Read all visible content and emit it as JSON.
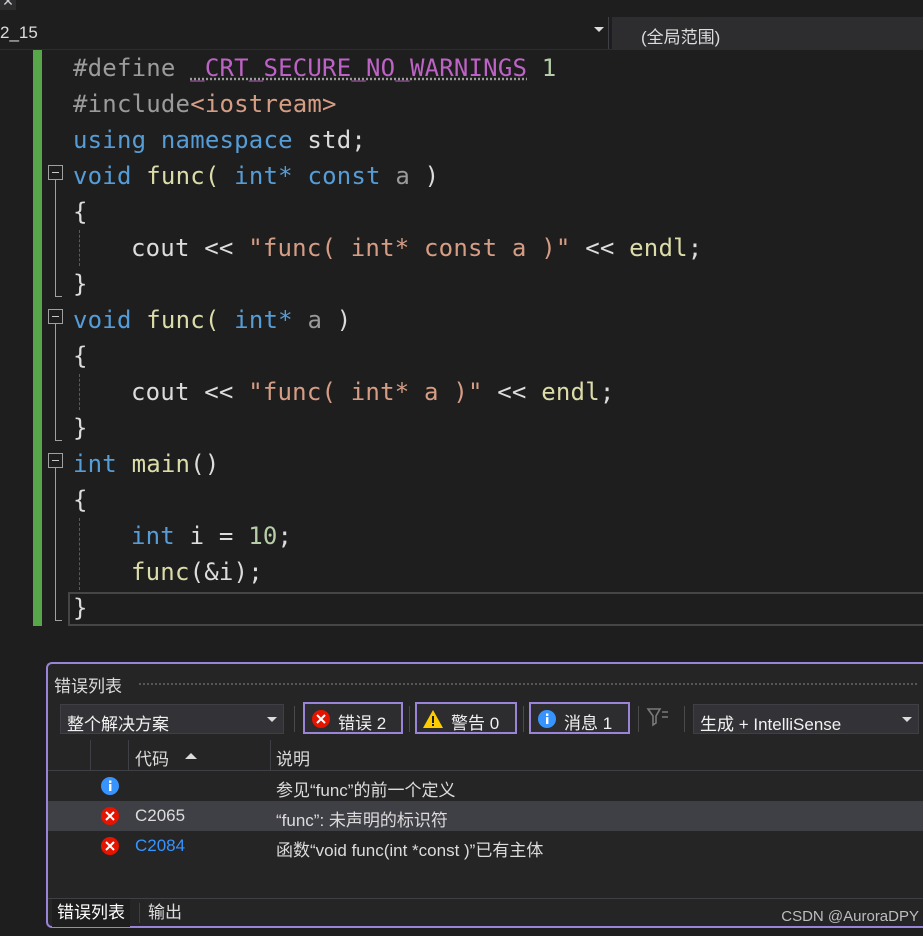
{
  "navigation": {
    "file_selector": "2_15",
    "scope_selector": "(全局范围)"
  },
  "editor": {
    "line1": {
      "kw": "#define",
      "macro": "_CRT_SECURE_NO_WARNINGS",
      "val": "1"
    },
    "line2": {
      "kw": "#include",
      "hdr": "<iostream>"
    },
    "line3": {
      "kw1": "using",
      "kw2": "namespace",
      "id": "std;"
    },
    "line4": {
      "kw": "void",
      "fn": "func(",
      "t": "int*",
      "c": "const",
      "p": "a",
      "close": ")"
    },
    "line5": "{",
    "line6": {
      "id": "cout",
      "op": "<<",
      "str": "\"func( int* const a )\"",
      "op2": "<<",
      "fn": "endl",
      "semi": ";"
    },
    "line7": "}",
    "line8": {
      "kw": "void",
      "fn": "func(",
      "t": "int*",
      "p": "a",
      "close": ")"
    },
    "line9": "{",
    "line10": {
      "id": "cout",
      "op": "<<",
      "str": "\"func( int* a )\"",
      "op2": "<<",
      "fn": "endl",
      "semi": ";"
    },
    "line11": "}",
    "line12": {
      "kw": "int",
      "fn": "main",
      "paren": "()"
    },
    "line13": "{",
    "line14": {
      "kw": "int",
      "id": "i",
      "eq": "=",
      "num": "10",
      "semi": ";"
    },
    "line15": {
      "fn": "func",
      "args": "(&i);"
    },
    "line16": "}"
  },
  "error_list": {
    "title": "错误列表",
    "scope": "整个解决方案",
    "errors_label": "错误 2",
    "warnings_label": "警告 0",
    "messages_label": "消息 1",
    "build_source": "生成 + IntelliSense",
    "col_code": "代码",
    "col_desc": "说明",
    "rows": [
      {
        "type": "info",
        "code": "",
        "desc": "参见“func”的前一个定义"
      },
      {
        "type": "error",
        "code": "C2065",
        "desc": "“func”: 未声明的标识符"
      },
      {
        "type": "error",
        "code": "C2084",
        "desc": "函数“void func(int *const )”已有主体"
      }
    ],
    "tabs": [
      "错误列表",
      "输出"
    ]
  },
  "colors": {
    "accent": "#9a84d8",
    "error": "#e51400",
    "warning": "#ffcc00",
    "info": "#3794ff",
    "change_bar": "#57a64a"
  },
  "watermark": "CSDN @AuroraDPY"
}
